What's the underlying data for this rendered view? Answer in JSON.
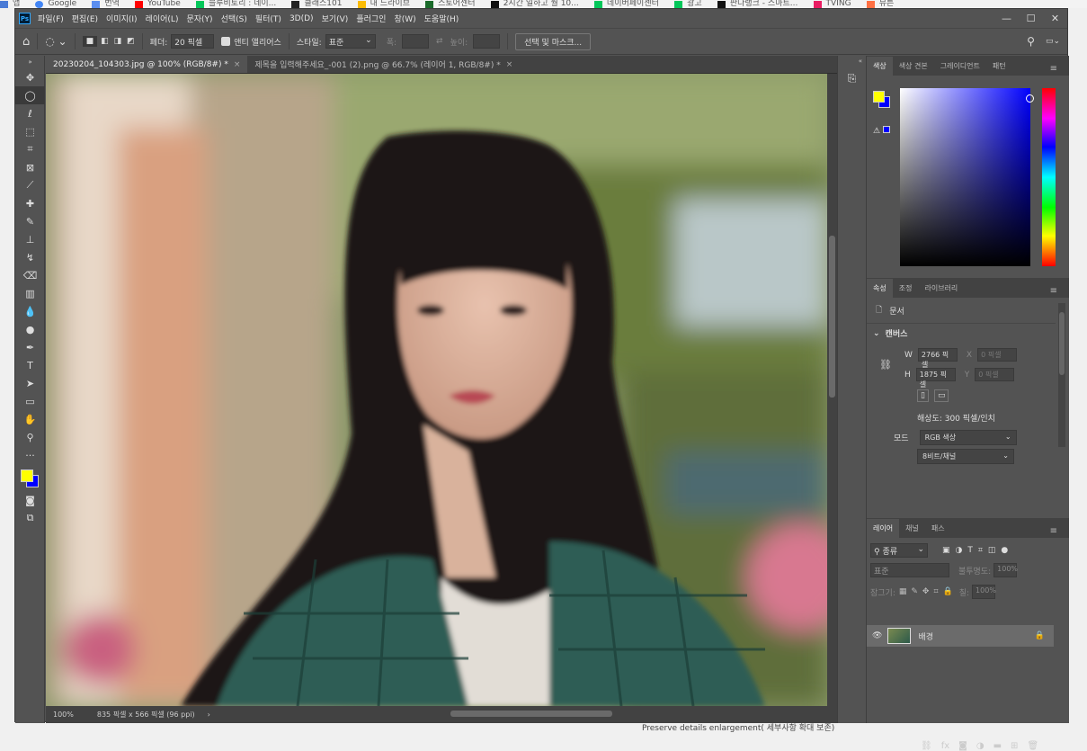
{
  "bookmarks": [
    "앱",
    "Google",
    "번역",
    "YouTube",
    "블루비토리 : 네이...",
    "클래스101",
    "내 드라이브",
    "스토어센터",
    "2시간 일하고 월 10...",
    "네이버페이센터",
    "광고",
    "판다랭크 - 스마트...",
    "TVING",
    "뮤튼"
  ],
  "menu": {
    "logo": "Ps",
    "items": [
      "파일(F)",
      "편집(E)",
      "이미지(I)",
      "레이어(L)",
      "문자(Y)",
      "선택(S)",
      "필터(T)",
      "3D(D)",
      "보기(V)",
      "플러그인",
      "창(W)",
      "도움말(H)"
    ],
    "min": "—",
    "max": "☐",
    "close": "✕"
  },
  "options": {
    "feather_label": "페더:",
    "feather_value": "20 픽셀",
    "antialias_label": "앤티 앨리어스",
    "style_label": "스타일:",
    "style_value": "표준",
    "width_label": "폭:",
    "height_label": "높이:",
    "mask_button": "선택 및 마스크..."
  },
  "tabs": [
    {
      "label": "20230204_104303.jpg @ 100% (RGB/8#) *",
      "close": "×"
    },
    {
      "label": "제목을 입력해주세요_-001 (2).png @ 66.7% (레이어 1, RGB/8#) *",
      "close": "×"
    }
  ],
  "status": {
    "zoom": "100%",
    "info": "835 픽셀 x 566 픽셀 (96 ppi)",
    "arrow": "›"
  },
  "colors": {
    "foreground": "#ffff00",
    "background": "#0000ff"
  },
  "color_panel": {
    "tabs": [
      "색상",
      "색상 견본",
      "그레이디언트",
      "패턴"
    ]
  },
  "properties": {
    "tabs": [
      "속성",
      "조정",
      "라이브러리"
    ],
    "doc_label": "문서",
    "canvas_label": "캔버스",
    "w_label": "W",
    "w_value": "2766 픽셀",
    "x_label": "X",
    "x_value": "0 픽셀",
    "h_label": "H",
    "h_value": "1875 픽셀",
    "y_label": "Y",
    "y_value": "0 픽셀",
    "resolution": "해상도: 300 픽셀/인치",
    "mode_label": "모드",
    "mode_value": "RGB 색상",
    "depth_value": "8비트/채널"
  },
  "layers_panel": {
    "tabs": [
      "레이어",
      "채널",
      "패스"
    ],
    "kind": "종류",
    "blend": "표준",
    "opacity_label": "불투명도:",
    "opacity_value": "100%",
    "lock_label": "잠그기:",
    "fill_label": "칠:",
    "fill_value": "100%",
    "layer_name": "배경"
  },
  "taskbar_text": "Preserve details enlargement( 세부사항 확대 보존)"
}
